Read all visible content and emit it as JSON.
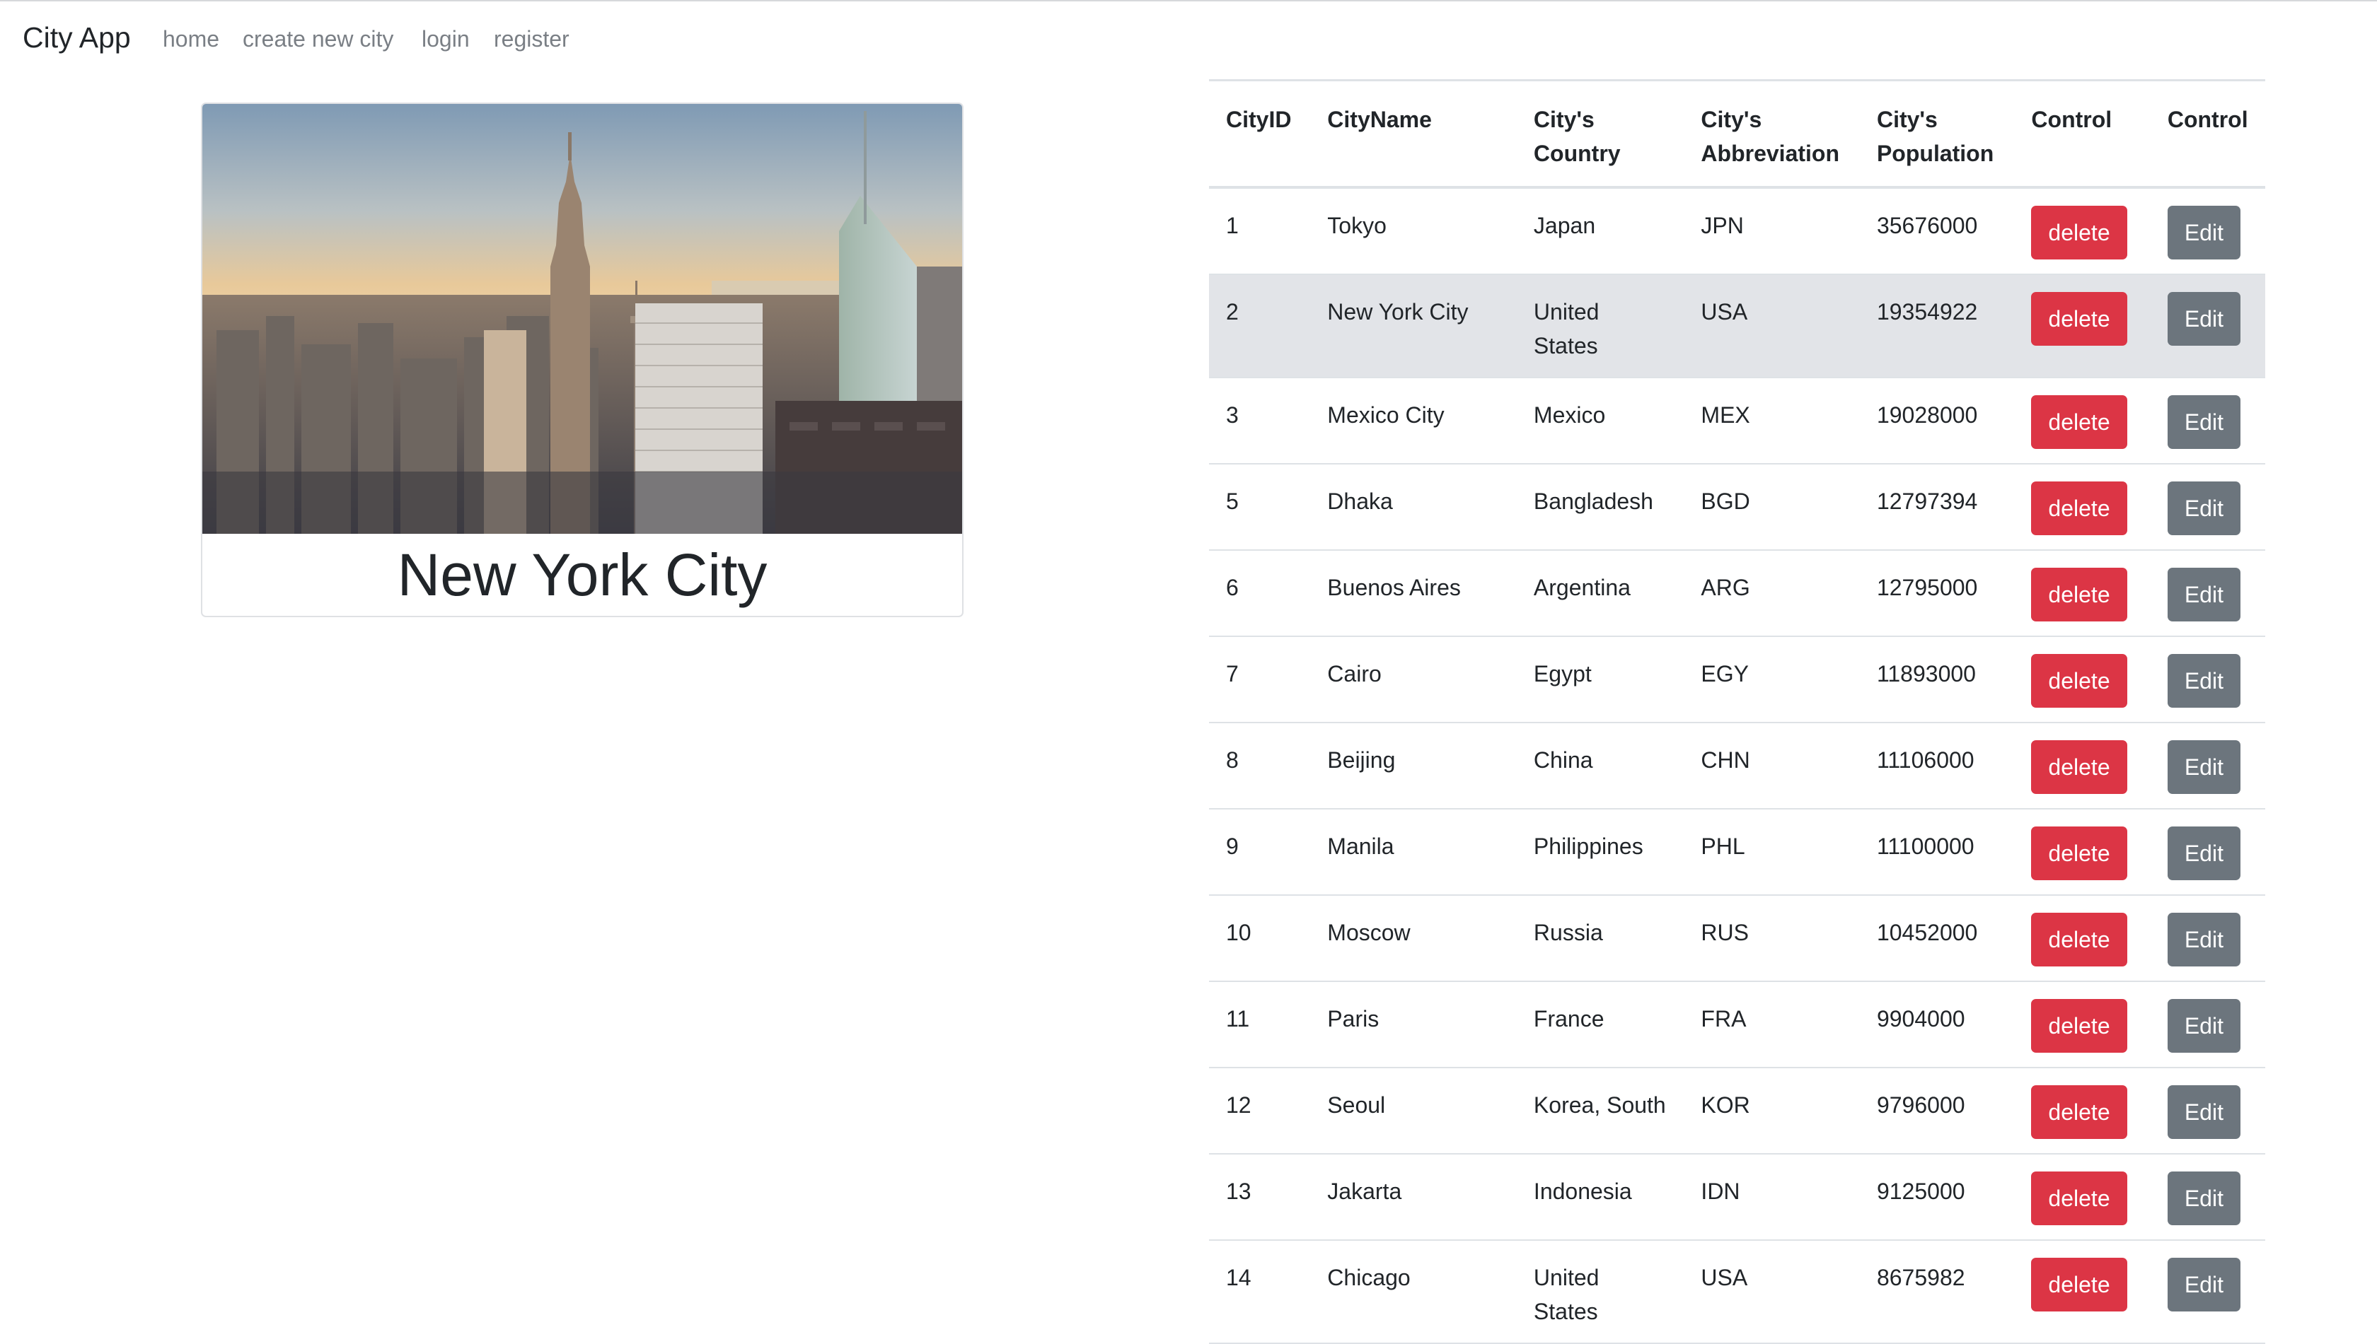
{
  "navbar": {
    "brand": "City App",
    "links": [
      "home",
      "create new city",
      "login",
      "register"
    ]
  },
  "featured": {
    "title": "New York City",
    "image": "skyline photo of New York City at sunset"
  },
  "table": {
    "headers": [
      "CityID",
      "CityName",
      "City's Country",
      "City's Abbreviation",
      "City's Population",
      "Control",
      "Control"
    ],
    "delete_label": "delete",
    "edit_label": "Edit",
    "rows": [
      {
        "id": "1",
        "name": "Tokyo",
        "country": "Japan",
        "abbr": "JPN",
        "population": "35676000"
      },
      {
        "id": "2",
        "name": "New York City",
        "country": "United States",
        "abbr": "USA",
        "population": "19354922"
      },
      {
        "id": "3",
        "name": "Mexico City",
        "country": "Mexico",
        "abbr": "MEX",
        "population": "19028000"
      },
      {
        "id": "5",
        "name": "Dhaka",
        "country": "Bangladesh",
        "abbr": "BGD",
        "population": "12797394"
      },
      {
        "id": "6",
        "name": "Buenos Aires",
        "country": "Argentina",
        "abbr": "ARG",
        "population": "12795000"
      },
      {
        "id": "7",
        "name": "Cairo",
        "country": "Egypt",
        "abbr": "EGY",
        "population": "11893000"
      },
      {
        "id": "8",
        "name": "Beijing",
        "country": "China",
        "abbr": "CHN",
        "population": "11106000"
      },
      {
        "id": "9",
        "name": "Manila",
        "country": "Philippines",
        "abbr": "PHL",
        "population": "11100000"
      },
      {
        "id": "10",
        "name": "Moscow",
        "country": "Russia",
        "abbr": "RUS",
        "population": "10452000"
      },
      {
        "id": "11",
        "name": "Paris",
        "country": "France",
        "abbr": "FRA",
        "population": "9904000"
      },
      {
        "id": "12",
        "name": "Seoul",
        "country": "Korea, South",
        "abbr": "KOR",
        "population": "9796000"
      },
      {
        "id": "13",
        "name": "Jakarta",
        "country": "Indonesia",
        "abbr": "IDN",
        "population": "9125000"
      },
      {
        "id": "14",
        "name": "Chicago",
        "country": "United States",
        "abbr": "USA",
        "population": "8675982"
      }
    ]
  },
  "colors": {
    "danger": "#dc3545",
    "secondary": "#6c757d",
    "row_hover": "#e2e4e8"
  }
}
